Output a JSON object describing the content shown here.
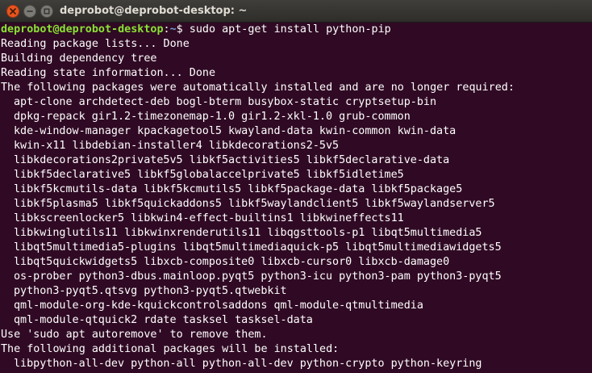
{
  "window": {
    "title": "deprobot@deprobot-desktop: ~"
  },
  "prompt": {
    "user_host": "deprobot@deprobot-desktop",
    "separator": ":",
    "path": "~",
    "symbol": "$ ",
    "command": "sudo apt-get install python-pip"
  },
  "output": {
    "lines_before": [
      "Reading package lists... Done",
      "Building dependency tree",
      "Reading state information... Done",
      "The following packages were automatically installed and are no longer required:"
    ],
    "auto_installed": [
      "apt-clone archdetect-deb bogl-bterm busybox-static cryptsetup-bin",
      "dpkg-repack gir1.2-timezonemap-1.0 gir1.2-xkl-1.0 grub-common",
      "kde-window-manager kpackagetool5 kwayland-data kwin-common kwin-data",
      "kwin-x11 libdebian-installer4 libkdecorations2-5v5",
      "libkdecorations2private5v5 libkf5activities5 libkf5declarative-data",
      "libkf5declarative5 libkf5globalaccelprivate5 libkf5idletime5",
      "libkf5kcmutils-data libkf5kcmutils5 libkf5package-data libkf5package5",
      "libkf5plasma5 libkf5quickaddons5 libkf5waylandclient5 libkf5waylandserver5",
      "libkscreenlocker5 libkwin4-effect-builtins1 libkwineffects11",
      "libkwinglutils11 libkwinxrenderutils11 libqgsttools-p1 libqt5multimedia5",
      "libqt5multimedia5-plugins libqt5multimediaquick-p5 libqt5multimediawidgets5",
      "libqt5quickwidgets5 libxcb-composite0 libxcb-cursor0 libxcb-damage0",
      "os-prober python3-dbus.mainloop.pyqt5 python3-icu python3-pam python3-pyqt5",
      "python3-pyqt5.qtsvg python3-pyqt5.qtwebkit",
      "qml-module-org-kde-kquickcontrolsaddons qml-module-qtmultimedia",
      "qml-module-qtquick2 rdate tasksel tasksel-data"
    ],
    "autoremove_hint": "Use 'sudo apt autoremove' to remove them.",
    "additional_header": "The following additional packages will be installed:",
    "additional_packages": [
      "libpython-all-dev python-all python-all-dev python-crypto python-keyring"
    ]
  },
  "colors": {
    "background": "#300a24",
    "prompt_user": "#8ae234",
    "prompt_path": "#729fcf",
    "text": "#ffffff",
    "close_button": "#e9541f"
  }
}
